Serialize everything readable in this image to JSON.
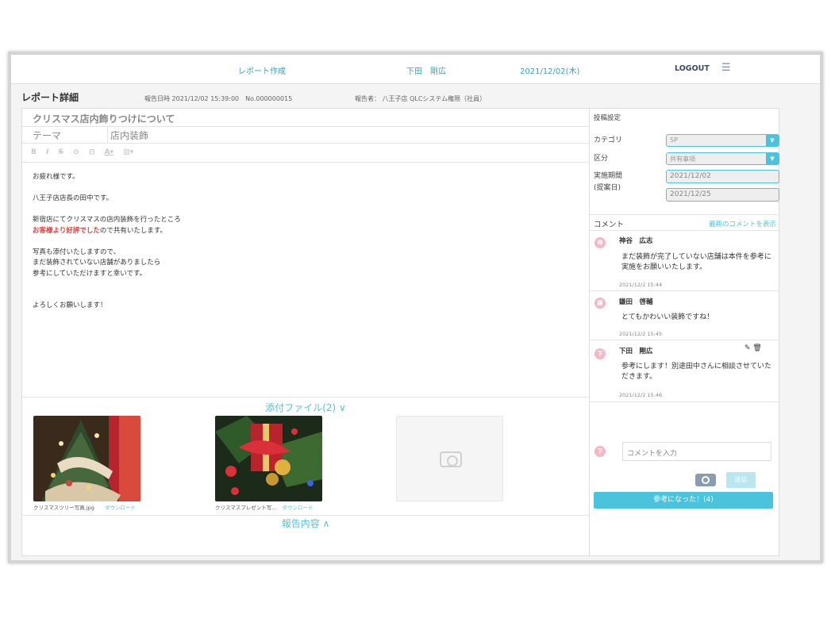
{
  "header": {
    "nav_create": "レポート作成",
    "user_name": "下田　剛広",
    "date": "2021/12/02(木)",
    "logout": "LOGOUT",
    "menu_icon": "☰"
  },
  "subheader": {
    "title": "レポート詳細",
    "report_datetime": "報告日時 2021/12/02 15:39:00　No.000000015",
    "reporter": "報告者： 八王子店 QLCシステム権限（社員）"
  },
  "report": {
    "subject": "クリスマス店内飾りつけについて",
    "theme_label": "テーマ",
    "theme_value": "店内装飾",
    "toolbar": [
      "B",
      "I",
      "S",
      "⊝",
      "⊟",
      "A▾",
      "▨▾"
    ],
    "body": {
      "l1": "お疲れ様です。",
      "l2": "八王子店店長の田中です。",
      "l3": "新宿店にてクリスマスの店内装飾を行ったところ",
      "l4_red": "お客様より好評でした",
      "l4_rest": "ので共有いたします。",
      "l5": "写真も添付いたしますので、",
      "l6": "まだ装飾されていない店舗がありましたら",
      "l7": "参考にしていただけますと幸いです。",
      "l8": "よろしくお願いします！"
    },
    "attachments_head": "添付ファイル(2) ∨",
    "attachments": [
      {
        "name": "クリスマスツリー写真.jpg",
        "download": "ダウンロード"
      },
      {
        "name": "クリスマスプレゼント写…",
        "download": "ダウンロード"
      }
    ],
    "report_head": "報告内容 ∧"
  },
  "settings": {
    "title": "投稿設定",
    "category_label": "カテゴリ",
    "category_value": "SP",
    "division_label": "区分",
    "division_value": "共有事項",
    "period_label_1": "実施期間",
    "period_label_2": "(提案日)",
    "date_from": "2021/12/02",
    "date_to": "2021/12/25"
  },
  "comments": {
    "label": "コメント",
    "show_latest": "最新のコメントを表示",
    "items": [
      {
        "avatar": "神",
        "name": "神谷　広志",
        "text": "まだ装飾が完了していない店舗は本件を参考に実施をお願いいたします。",
        "time": "2021/12/2 15:44"
      },
      {
        "avatar": "鎌",
        "name": "鎌田　啓輔",
        "text": "とてもかわいい装飾ですね！",
        "time": "2021/12/2 15:45"
      },
      {
        "avatar": "下",
        "name": "下田　剛広",
        "text": "参考にします！別途田中さんに相談させていただきます。",
        "time": "2021/12/2 15:46"
      }
    ],
    "edit_icons": "✎ 🗑",
    "input_avatar": "下",
    "input_placeholder": "コメントを入力",
    "send": "送信",
    "helpful": "参考になった！(4)"
  },
  "colors": {
    "accent": "#4cc3dd",
    "red": "#e53935",
    "avatar": "#f6b7c4"
  }
}
